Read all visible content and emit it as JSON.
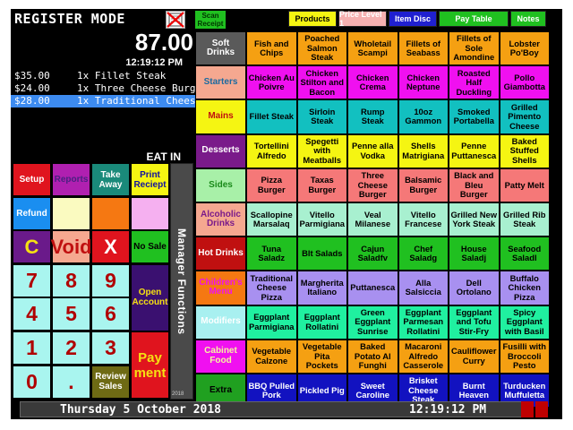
{
  "header": {
    "mode_title": "REGISTER MODE",
    "total": "87.00",
    "time": "12:19:12 PM",
    "order_type": "EAT IN"
  },
  "order_items": [
    {
      "price": "$35.00",
      "desc": "1x Fillet Steak",
      "selected": false
    },
    {
      "price": "$24.00",
      "desc": "1x Three Cheese Burger",
      "selected": false
    },
    {
      "price": "$28.00",
      "desc": "1x Traditional Cheese Pizza",
      "selected": true
    }
  ],
  "keypad": [
    {
      "label": "Setup",
      "bg": "#e0141e",
      "fg": "#ffffff",
      "size": "md",
      "name": "setup-button"
    },
    {
      "label": "Reports",
      "bg": "#b020b0",
      "fg": "#4a2080",
      "size": "sm",
      "name": "reports-button"
    },
    {
      "label": "Take Away",
      "bg": "#1a8a7a",
      "fg": "#ffffff",
      "size": "sm",
      "name": "take-away-button"
    },
    {
      "label": "Print Reciept",
      "bg": "#f5f512",
      "fg": "#1010a0",
      "size": "sm",
      "name": "print-receipt-button"
    },
    {
      "label": "Refund",
      "bg": "#1a8ef0",
      "fg": "#ffffff",
      "size": "sm",
      "name": "refund-button"
    },
    {
      "label": "",
      "bg": "#fafac0",
      "fg": "#000000",
      "size": "sm",
      "name": "blank-key-1"
    },
    {
      "label": "",
      "bg": "#f57812",
      "fg": "#000000",
      "size": "sm",
      "name": "blank-key-2"
    },
    {
      "label": "",
      "bg": "#f5b0f0",
      "fg": "#000000",
      "size": "sm",
      "name": "blank-key-3"
    },
    {
      "label": "C",
      "bg": "#6a1a8a",
      "fg": "#f5e012",
      "size": "big",
      "name": "clear-button"
    },
    {
      "label": "Void",
      "bg": "#f5a890",
      "fg": "#c01010",
      "size": "big",
      "name": "void-button"
    },
    {
      "label": "X",
      "bg": "#e0141e",
      "fg": "#ffffff",
      "size": "big",
      "name": "multiply-button"
    },
    {
      "label": "No Sale",
      "bg": "#20c020",
      "fg": "#000000",
      "size": "sm",
      "name": "no-sale-button"
    },
    {
      "label": "7",
      "size": "num",
      "name": "key-7"
    },
    {
      "label": "8",
      "size": "num",
      "name": "key-8"
    },
    {
      "label": "9",
      "size": "num",
      "name": "key-9"
    },
    {
      "label": "4",
      "size": "num",
      "name": "key-4"
    },
    {
      "label": "5",
      "size": "num",
      "name": "key-5"
    },
    {
      "label": "6",
      "size": "num",
      "name": "key-6"
    },
    {
      "label": "1",
      "size": "num",
      "name": "key-1"
    },
    {
      "label": "2",
      "size": "num",
      "name": "key-2"
    },
    {
      "label": "3",
      "size": "num",
      "name": "key-3"
    },
    {
      "label": "0",
      "size": "num",
      "name": "key-0"
    },
    {
      "label": ".",
      "size": "num",
      "name": "key-decimal"
    },
    {
      "label": "Review Sales",
      "bg": "#6e6a14",
      "fg": "#ffffff",
      "size": "sm",
      "name": "review-sales-button"
    }
  ],
  "open_account": {
    "label": "Open Account",
    "bg": "#3a1070",
    "fg": "#f5e012"
  },
  "payment": {
    "label": "Pay ment",
    "bg": "#e0141e",
    "fg": "#f5e012"
  },
  "manager": {
    "label": "Manager Functions",
    "year": "2018"
  },
  "scan_receipt": "Scan Receipt",
  "tabs": [
    {
      "label": "Products",
      "bg": "#f5f512",
      "fg": "#000000"
    },
    {
      "label": "Price Level 1",
      "bg": "#f5b0b0",
      "fg": "#ffffff"
    },
    {
      "label": "Item Disc",
      "bg": "#2020d0",
      "fg": "#ffffff"
    },
    {
      "label": "Pay Table",
      "bg": "#20c020",
      "fg": "#ffffff"
    },
    {
      "label": "Notes",
      "bg": "#20c020",
      "fg": "#ffffff"
    }
  ],
  "grid": [
    {
      "category": {
        "label": "Soft Drinks",
        "bg": "#5a5a5a",
        "fg": "#ffffff"
      },
      "bg": "#f5a012",
      "fg": "#000000",
      "items": [
        "Fish and Chips",
        "Poached Salmon Steak",
        "Wholetail Scampi",
        "Fillets of Seabass",
        "Fillets of Sole Amondine",
        "Lobster Po'Boy"
      ]
    },
    {
      "category": {
        "label": "Starters",
        "bg": "#f5a890",
        "fg": "#1a6aa0"
      },
      "bg": "#f010f0",
      "fg": "#000000",
      "items": [
        "Chicken Au Poivre",
        "Chicken Stilton and Bacon",
        "Chicken Crema",
        "Chicken Neptune",
        "Roasted Half Duckling",
        "Pollo Giambotta"
      ]
    },
    {
      "category": {
        "label": "Mains",
        "bg": "#f5f512",
        "fg": "#c01010"
      },
      "bg": "#12c0c0",
      "fg": "#000000",
      "items": [
        "Fillet Steak",
        "Sirloin Steak",
        "Rump Steak",
        "10oz Gammon",
        "Smoked Portabella",
        "Grilled Pimento Cheese"
      ]
    },
    {
      "category": {
        "label": "Desserts",
        "bg": "#7a1a8a",
        "fg": "#ffffff"
      },
      "bg": "#f5f512",
      "fg": "#000000",
      "items": [
        "Tortellini Alfredo",
        "Spegetti with Meatballs",
        "Penne alla Vodka",
        "Shells Matrigiana",
        "Penne Puttanesca",
        "Baked Stuffed Shells"
      ]
    },
    {
      "category": {
        "label": "Sides",
        "bg": "#a8f0a8",
        "fg": "#1a8a1a"
      },
      "bg": "#f57878",
      "fg": "#000000",
      "items": [
        "Pizza Burger",
        "Taxas Burger",
        "Three Cheese Burger",
        "Balsamic Burger",
        "Black and Bleu Burger",
        "Patty Melt"
      ]
    },
    {
      "category": {
        "label": "Alcoholic Drinks",
        "bg": "#f5a890",
        "fg": "#7a1a8a"
      },
      "bg": "#a8f0d0",
      "fg": "#000000",
      "items": [
        "Scallopine Marsalaq",
        "Vitello Parmigiana",
        "Veal Milanese",
        "Vitello Francese",
        "Grilled New York Steak",
        "Grilled Rib Steak"
      ]
    },
    {
      "category": {
        "label": "Hot Drinks",
        "bg": "#c01010",
        "fg": "#ffffff"
      },
      "bg": "#20c020",
      "fg": "#000000",
      "items": [
        "Tuna Saladz",
        "Blt Salads",
        "Cajun Saladfv",
        "Chef Saladg",
        "House Saladj",
        "Seafood Saladl"
      ]
    },
    {
      "category": {
        "label": "Children's Menu",
        "bg": "#f57812",
        "fg": "#f010f0"
      },
      "bg": "#a890f0",
      "fg": "#000000",
      "items": [
        "Traditional Cheese Pizza",
        "Margherita Italiano",
        "Puttanesca",
        "Alla Salsiccia",
        "Dell Ortolano",
        "Buffalo Chicken Pizza"
      ]
    },
    {
      "category": {
        "label": "Modifiers",
        "bg": "#a8f0f0",
        "fg": "#ffffff"
      },
      "bg": "#20f0a0",
      "fg": "#000000",
      "items": [
        "Eggplant Parmigiana",
        "Eggplant Rollatini",
        "Green Eggplant Sunrise",
        "Eggplant Parmesan Rollatini",
        "Eggplant and Tofu Stir-Fry",
        "Spicy Eggplant with Basil"
      ]
    },
    {
      "category": {
        "label": "Cabinet Food",
        "bg": "#f010f0",
        "fg": "#f5f5a0"
      },
      "bg": "#f5a012",
      "fg": "#000000",
      "items": [
        "Vegetable Calzone",
        "Vegetable Pita Pockets",
        "Baked Potato Al Funghi",
        "Macaroni Alfredo Casserole",
        "Cauliflower Curry",
        "Fusilli with Broccoli Pesto"
      ]
    },
    {
      "category": {
        "label": "Extra",
        "bg": "#20a020",
        "fg": "#000000"
      },
      "bg": "#1212c0",
      "fg": "#ffffff",
      "items": [
        "BBQ Pulled Pork",
        "Pickled Pig",
        "Sweet Caroline",
        "Brisket Cheese Steak",
        "Burnt Heaven",
        "Turducken Muffuletta"
      ]
    }
  ],
  "status": {
    "date": "Thursday 5 October 2018",
    "time": "12:19:12 PM"
  }
}
